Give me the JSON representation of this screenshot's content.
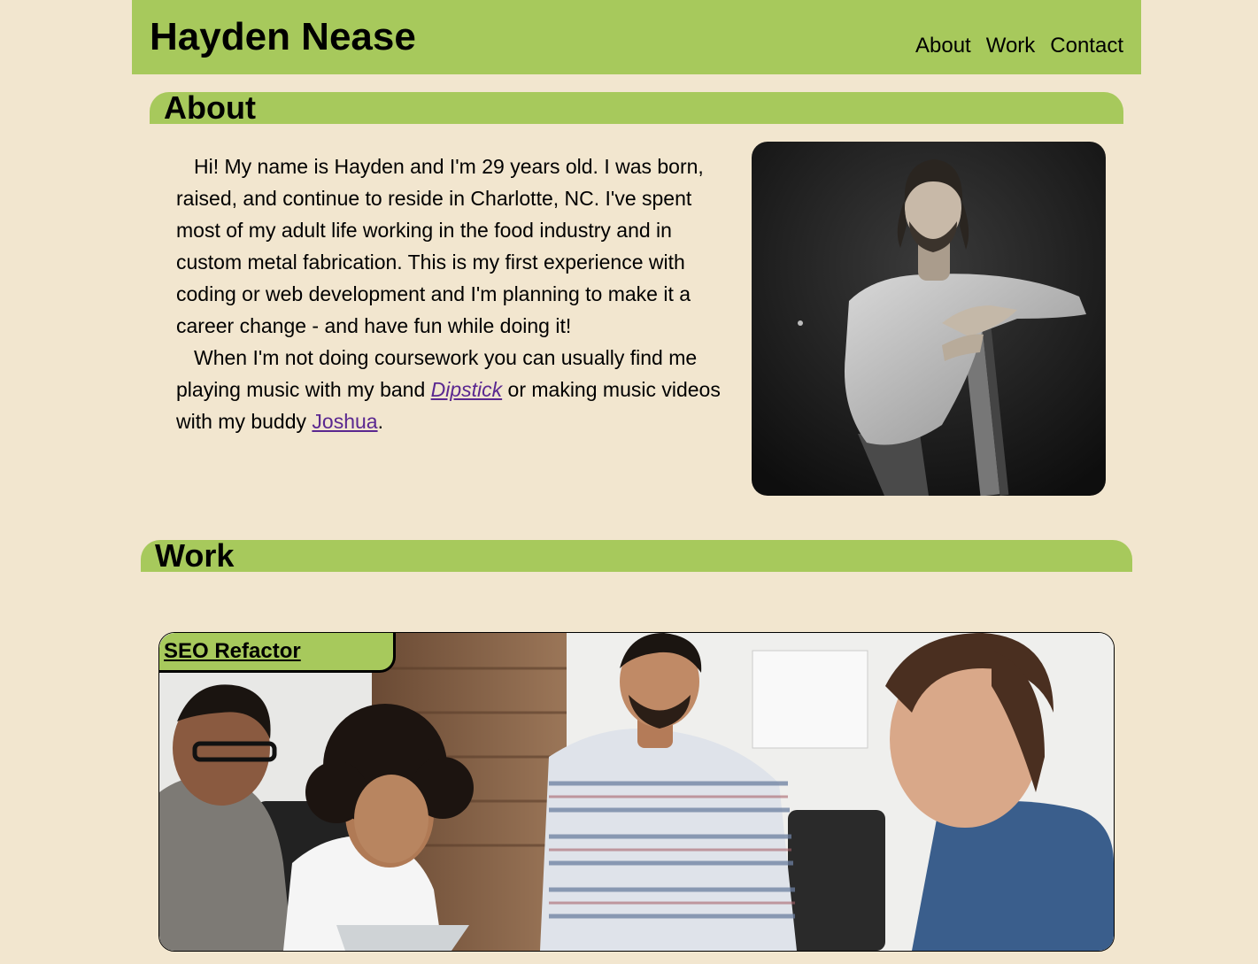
{
  "header": {
    "title": "Hayden Nease",
    "nav": [
      "About",
      "Work",
      "Contact"
    ]
  },
  "about": {
    "heading": "About",
    "p1": "Hi! My name is Hayden and I'm 29 years old. I was born, raised, and continue to reside in Charlotte, NC. I've spent most of my adult life working in the food industry and in custom metal fabrication. This is my first experience with coding or web development and I'm planning to make it a career change - and have fun while doing it!",
    "p2_before": "When I'm not doing coursework you can usually find me playing music with my band ",
    "band_link": "Dipstick",
    "p2_middle": " or making music videos with my buddy ",
    "buddy_link": "Joshua",
    "p2_end": "."
  },
  "work": {
    "heading": "Work",
    "project_title": "SEO Refactor"
  },
  "colors": {
    "accent": "#a7c95c",
    "background": "#f2e6cf",
    "link": "#5a2790"
  }
}
